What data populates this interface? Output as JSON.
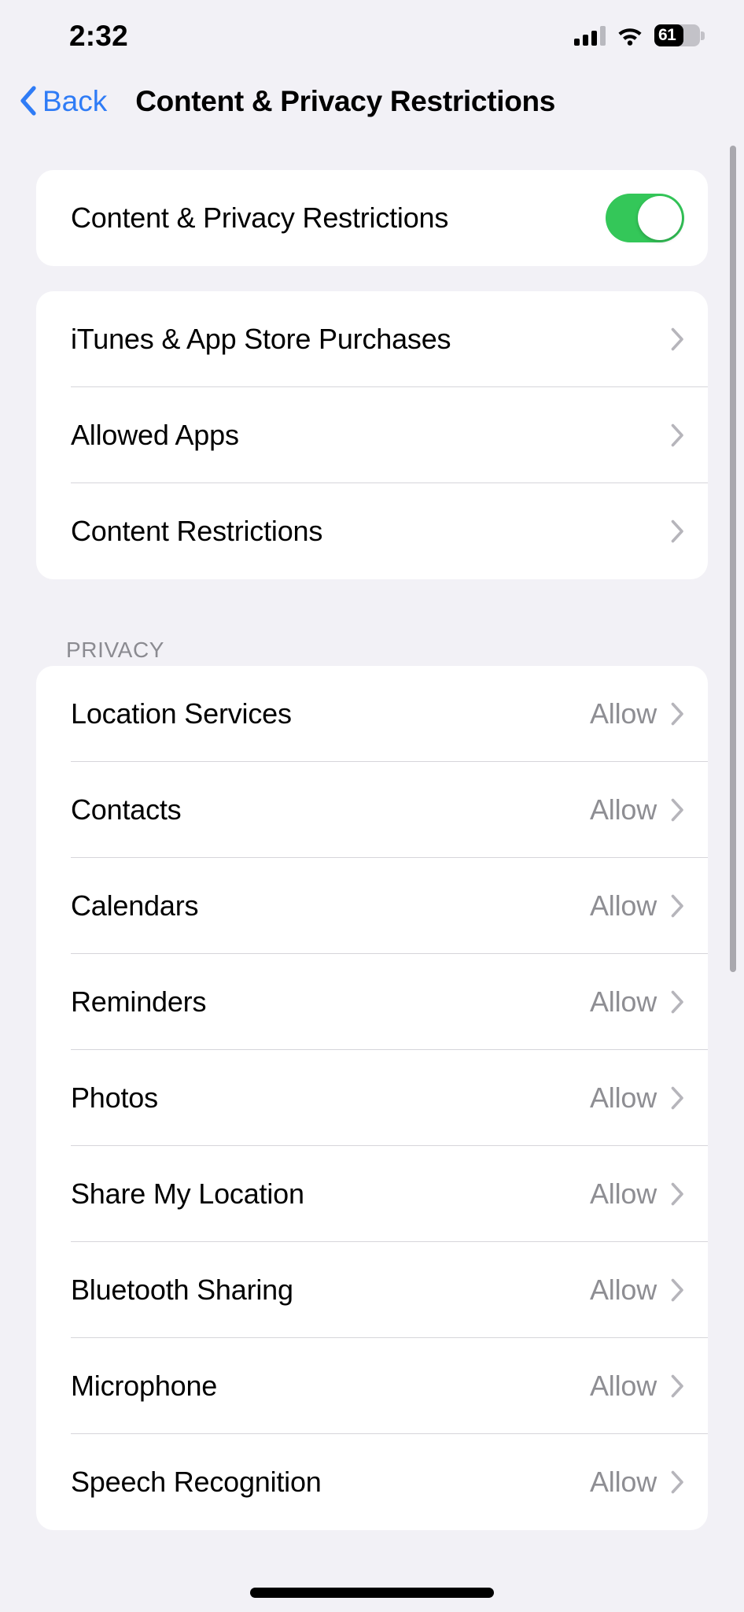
{
  "status_bar": {
    "time": "2:32",
    "battery_percent": "61",
    "battery_level": 61,
    "signal_bars_filled": 3,
    "signal_bars_total": 4,
    "wifi": "wifi-icon"
  },
  "nav": {
    "back_label": "Back",
    "title": "Content & Privacy Restrictions"
  },
  "main_toggle": {
    "label": "Content & Privacy Restrictions",
    "state": "on",
    "on_color": "#34c759"
  },
  "restrictions_group": {
    "rows": [
      {
        "label": "iTunes & App Store Purchases"
      },
      {
        "label": "Allowed Apps"
      },
      {
        "label": "Content Restrictions"
      }
    ]
  },
  "privacy_section": {
    "header": "PRIVACY",
    "rows": [
      {
        "label": "Location Services",
        "value": "Allow"
      },
      {
        "label": "Contacts",
        "value": "Allow"
      },
      {
        "label": "Calendars",
        "value": "Allow"
      },
      {
        "label": "Reminders",
        "value": "Allow"
      },
      {
        "label": "Photos",
        "value": "Allow"
      },
      {
        "label": "Share My Location",
        "value": "Allow"
      },
      {
        "label": "Bluetooth Sharing",
        "value": "Allow"
      },
      {
        "label": "Microphone",
        "value": "Allow"
      },
      {
        "label": "Speech Recognition",
        "value": "Allow"
      }
    ]
  },
  "colors": {
    "accent_blue": "#2f7cf6",
    "toggle_green": "#34c759",
    "background": "#f2f1f6",
    "card": "#ffffff",
    "secondary_text": "#8e8e93"
  }
}
